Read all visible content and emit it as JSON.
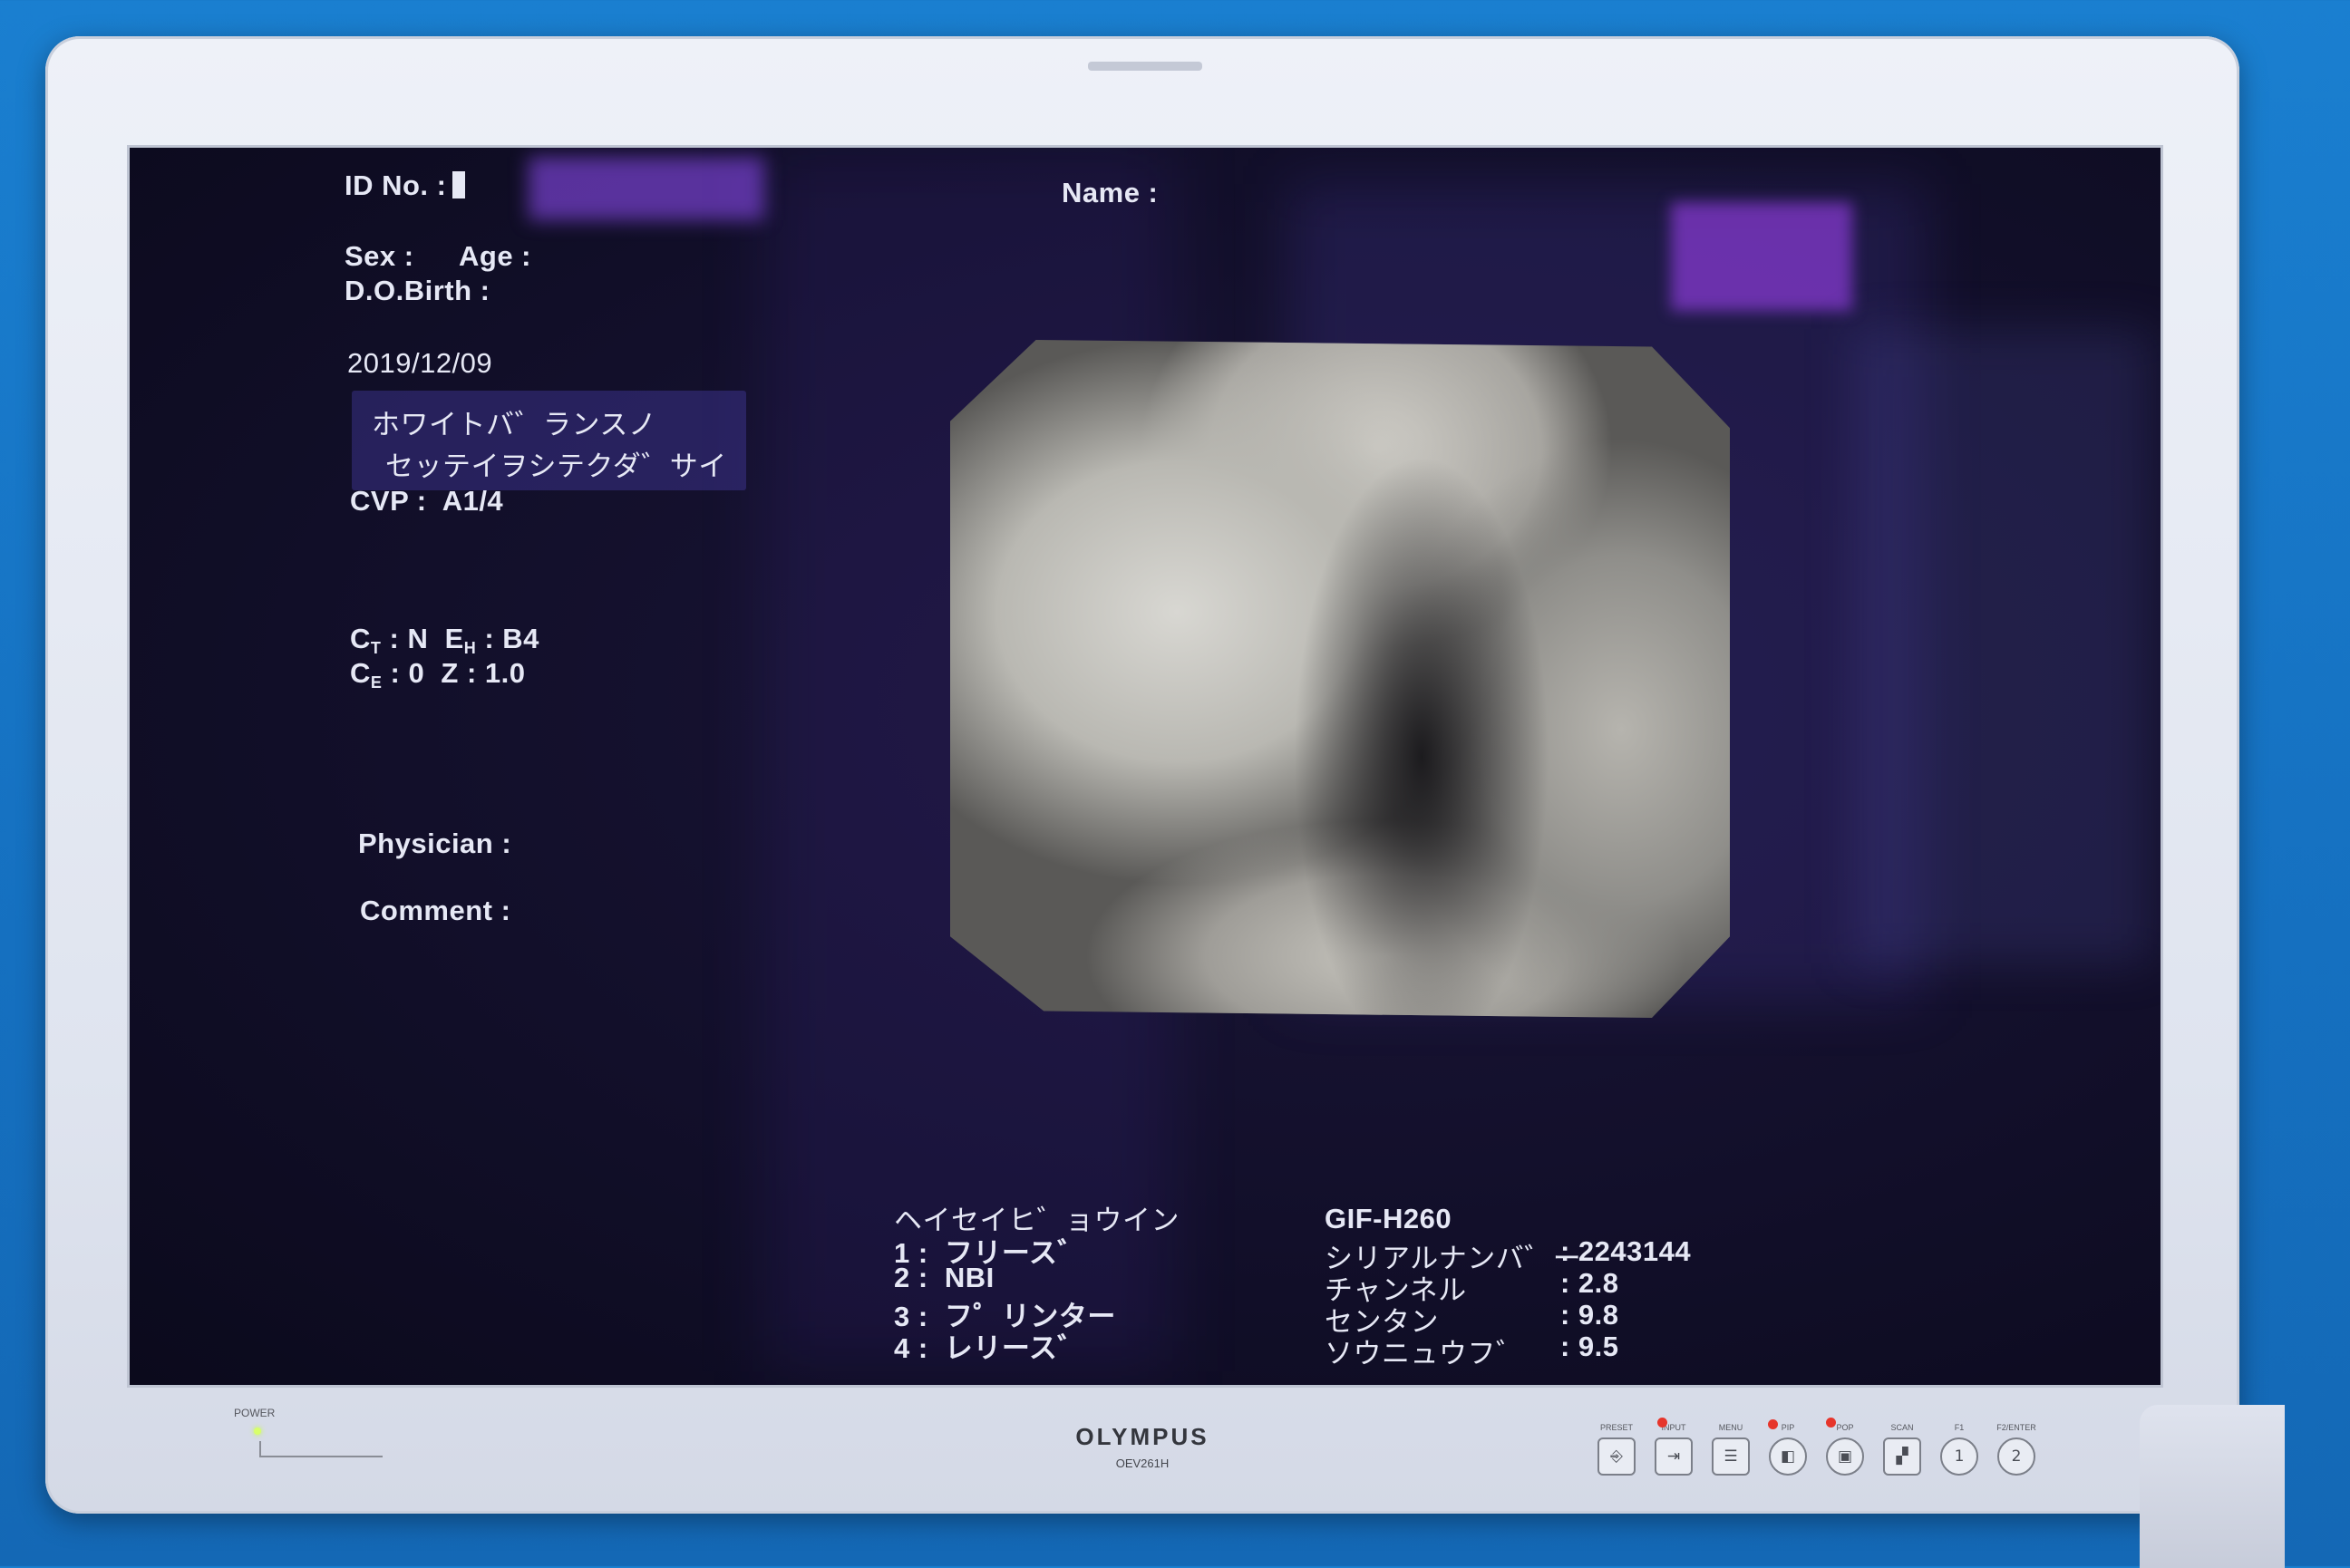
{
  "patient": {
    "id_label": "ID No. :",
    "name_label": "Name :",
    "sex_label": "Sex :",
    "age_label": "Age :",
    "dob_label": "D.O.Birth :",
    "date": "2019/12/09"
  },
  "message": {
    "line1": "ホワイトバ゛ランスノ",
    "line2": "セッテイヲシテクダ゛サイ"
  },
  "cvp": "CVP :  A1/4",
  "settings": {
    "ct_label": "C",
    "ct_sub": "T",
    "ct_value": " : N  ",
    "eh_label": "E",
    "eh_sub": "H",
    "eh_value": " : B4",
    "ce_label": "C",
    "ce_sub": "E",
    "ce_value": " : 0  Z : 1.0"
  },
  "physician_label": "Physician :",
  "comment_label": "Comment :",
  "hospital": {
    "name": "ヘイセイヒ゛ョウイン",
    "items": [
      "1 :  フリース゛",
      "2 :  NBI",
      "3 :  フ゜リンター",
      "4 :  レリース゛"
    ]
  },
  "scope": {
    "model": "GIF-H260",
    "rows": [
      {
        "label": "シリアルナンバ゛ー",
        "value": ": 2243144"
      },
      {
        "label": "チャンネル",
        "value": ": 2.8"
      },
      {
        "label": "センタン",
        "value": ": 9.8"
      },
      {
        "label": "ソウニュウフ゛",
        "value": ": 9.5"
      }
    ]
  },
  "monitor": {
    "brand": "OLYMPUS",
    "model": "OEV261H",
    "power_label": "POWER",
    "buttons": [
      {
        "label": "PRESET",
        "icon": "⎆"
      },
      {
        "label": "INPUT",
        "icon": "⇥"
      },
      {
        "label": "MENU",
        "icon": "☰"
      },
      {
        "label": "PIP",
        "icon": "◧"
      },
      {
        "label": "POP",
        "icon": "▣"
      },
      {
        "label": "SCAN",
        "icon": "▞"
      },
      {
        "label": "F1",
        "icon": "1"
      },
      {
        "label": "F2/ENTER",
        "icon": "2"
      }
    ]
  }
}
